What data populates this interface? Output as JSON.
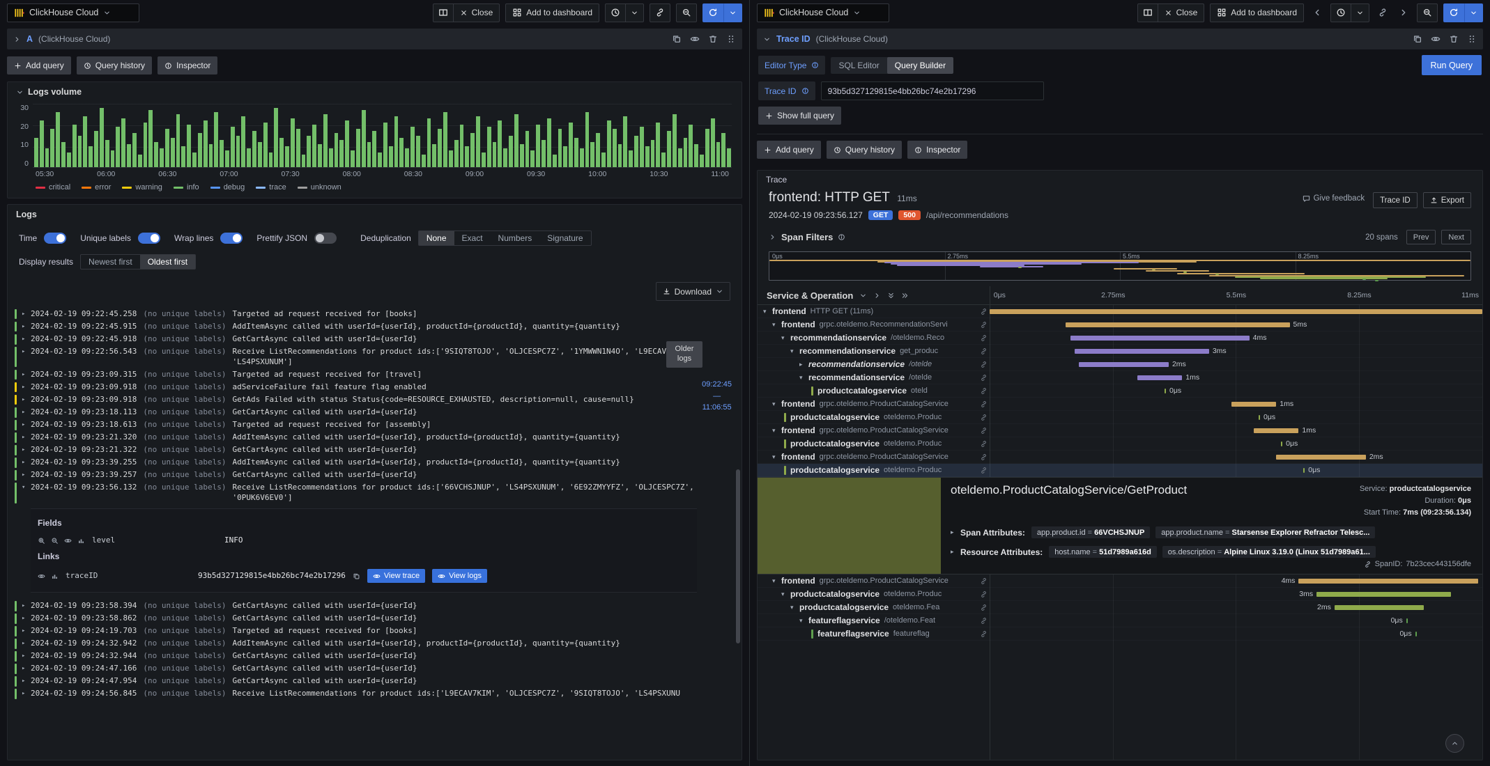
{
  "colors": {
    "accent": "#3d71d9",
    "method_badge": "#3d71d9",
    "status_badge": "#e0562f",
    "detail_block": "#565f2e",
    "levels": {
      "green": "#73bf69",
      "yellow": "#f2cc0c",
      "red": "#e02f44"
    },
    "services": {
      "frontend": "#c9a15c",
      "recommendationservice": "#8c7cc9",
      "productcatalogservice": "#8faa4b",
      "featureflagservice": "#5e9e4e"
    }
  },
  "left": {
    "toolbar": {
      "datasource": "ClickHouse Cloud",
      "close": "Close",
      "add_to_dashboard": "Add to dashboard"
    },
    "query": {
      "ref": "A",
      "datasource_hint": "(ClickHouse Cloud)",
      "add_query": "Add query",
      "query_history": "Query history",
      "inspector": "Inspector"
    },
    "logs_volume": {
      "title": "Logs volume",
      "y_ticks": [
        "30",
        "20",
        "10",
        "0"
      ],
      "x_ticks": [
        "05:30",
        "06:00",
        "06:30",
        "07:00",
        "07:30",
        "08:00",
        "08:30",
        "09:00",
        "09:30",
        "10:00",
        "10:30",
        "11:00"
      ],
      "legend": [
        {
          "label": "critical",
          "color": "#e02f44"
        },
        {
          "label": "error",
          "color": "#ff780a"
        },
        {
          "label": "warning",
          "color": "#f2cc0c"
        },
        {
          "label": "info",
          "color": "#73bf69"
        },
        {
          "label": "debug",
          "color": "#5794f2"
        },
        {
          "label": "trace",
          "color": "#8ab8ff"
        },
        {
          "label": "unknown",
          "color": "#9e9e9e"
        }
      ],
      "y_max": 30,
      "bars": [
        14,
        22,
        9,
        18,
        26,
        12,
        7,
        20,
        15,
        24,
        10,
        17,
        28,
        13,
        8,
        19,
        23,
        11,
        16,
        6,
        21,
        27,
        12,
        9,
        18,
        14,
        25,
        10,
        20,
        7,
        16,
        22,
        11,
        26,
        13,
        8,
        19,
        15,
        24,
        9,
        17,
        12,
        21,
        7,
        28,
        14,
        10,
        23,
        18,
        6,
        15,
        20,
        11,
        25,
        9,
        16,
        13,
        22,
        8,
        18,
        27,
        12,
        17,
        7,
        21,
        10,
        24,
        14,
        9,
        19,
        15,
        6,
        23,
        11,
        18,
        26,
        8,
        13,
        20,
        10,
        16,
        24,
        7,
        19,
        12,
        22,
        9,
        15,
        25,
        11,
        17,
        8,
        20,
        13,
        23,
        6,
        18,
        10,
        21,
        14,
        9,
        26,
        12,
        16,
        7,
        22,
        18,
        11,
        24,
        8,
        15,
        19,
        10,
        13,
        21,
        7,
        17,
        25,
        9,
        14,
        20,
        11,
        6,
        18,
        23,
        12,
        16,
        9
      ]
    },
    "logs": {
      "title": "Logs",
      "controls": {
        "time": "Time",
        "unique_labels": "Unique labels",
        "wrap_lines": "Wrap lines",
        "prettify_json": "Prettify JSON",
        "deduplication": "Deduplication",
        "dedup_options": [
          "None",
          "Exact",
          "Numbers",
          "Signature"
        ],
        "dedup_selected": "None",
        "display_results": "Display results",
        "order_options": [
          "Newest first",
          "Oldest first"
        ],
        "order_selected": "Oldest first",
        "download": "Download"
      },
      "older_logs": "Older logs",
      "time_marker": {
        "from": "09:22:45",
        "dash": "—",
        "to": "11:06:55"
      },
      "rows_before": [
        {
          "ts": "2024-02-19 09:22:45.258",
          "labels": "(no unique labels)",
          "msg": "Targeted ad request received for [books]",
          "level": "green"
        },
        {
          "ts": "2024-02-19 09:22:45.915",
          "labels": "(no unique labels)",
          "msg": "AddItemAsync called with userId={userId}, productId={productId}, quantity={quantity}",
          "level": "green"
        },
        {
          "ts": "2024-02-19 09:22:45.918",
          "labels": "(no unique labels)",
          "msg": "GetCartAsync called with userId={userId}",
          "level": "green"
        },
        {
          "ts": "2024-02-19 09:22:56.543",
          "labels": "(no unique labels)",
          "msg": "Receive ListRecommendations for product ids:['9SIQT8TOJO', 'OLJCESPC7Z', '1YMWWN1N4O', 'L9ECAV7KIM', 'LS4PSXUNUM']",
          "level": "green"
        },
        {
          "ts": "2024-02-19 09:23:09.315",
          "labels": "(no unique labels)",
          "msg": "Targeted ad request received for [travel]",
          "level": "green"
        },
        {
          "ts": "2024-02-19 09:23:09.918",
          "labels": "(no unique labels)",
          "msg": "adServiceFailure fail feature flag enabled",
          "level": "yellow"
        },
        {
          "ts": "2024-02-19 09:23:09.918",
          "labels": "(no unique labels)",
          "msg": "GetAds Failed with status Status{code=RESOURCE_EXHAUSTED, description=null, cause=null}",
          "level": "yellow"
        },
        {
          "ts": "2024-02-19 09:23:18.113",
          "labels": "(no unique labels)",
          "msg": "GetCartAsync called with userId={userId}",
          "level": "green"
        },
        {
          "ts": "2024-02-19 09:23:18.613",
          "labels": "(no unique labels)",
          "msg": "Targeted ad request received for [assembly]",
          "level": "green"
        },
        {
          "ts": "2024-02-19 09:23:21.320",
          "labels": "(no unique labels)",
          "msg": "AddItemAsync called with userId={userId}, productId={productId}, quantity={quantity}",
          "level": "green"
        },
        {
          "ts": "2024-02-19 09:23:21.322",
          "labels": "(no unique labels)",
          "msg": "GetCartAsync called with userId={userId}",
          "level": "green"
        },
        {
          "ts": "2024-02-19 09:23:39.255",
          "labels": "(no unique labels)",
          "msg": "AddItemAsync called with userId={userId}, productId={productId}, quantity={quantity}",
          "level": "green"
        },
        {
          "ts": "2024-02-19 09:23:39.257",
          "labels": "(no unique labels)",
          "msg": "GetCartAsync called with userId={userId}",
          "level": "green"
        },
        {
          "ts": "2024-02-19 09:23:56.132",
          "labels": "(no unique labels)",
          "msg": "Receive ListRecommendations for product ids:['66VCHSJNUP', 'LS4PSXUNUM', '6E92ZMYYFZ', 'OLJCESPC7Z', '0PUK6V6EV0']",
          "level": "green",
          "expanded": true
        }
      ],
      "expanded": {
        "fields_title": "Fields",
        "field_name": "level",
        "field_value": "INFO",
        "links_title": "Links",
        "link_name": "traceID",
        "link_value": "93b5d327129815e4bb26bc74e2b17296",
        "view_trace": "View trace",
        "view_logs": "View logs"
      },
      "rows_after": [
        {
          "ts": "2024-02-19 09:23:58.394",
          "labels": "(no unique labels)",
          "msg": "GetCartAsync called with userId={userId}",
          "level": "green"
        },
        {
          "ts": "2024-02-19 09:23:58.862",
          "labels": "(no unique labels)",
          "msg": "GetCartAsync called with userId={userId}",
          "level": "green"
        },
        {
          "ts": "2024-02-19 09:24:19.703",
          "labels": "(no unique labels)",
          "msg": "Targeted ad request received for [books]",
          "level": "green"
        },
        {
          "ts": "2024-02-19 09:24:32.942",
          "labels": "(no unique labels)",
          "msg": "AddItemAsync called with userId={userId}, productId={productId}, quantity={quantity}",
          "level": "green"
        },
        {
          "ts": "2024-02-19 09:24:32.944",
          "labels": "(no unique labels)",
          "msg": "GetCartAsync called with userId={userId}",
          "level": "green"
        },
        {
          "ts": "2024-02-19 09:24:47.166",
          "labels": "(no unique labels)",
          "msg": "GetCartAsync called with userId={userId}",
          "level": "green"
        },
        {
          "ts": "2024-02-19 09:24:47.954",
          "labels": "(no unique labels)",
          "msg": "GetCartAsync called with userId={userId}",
          "level": "green"
        },
        {
          "ts": "2024-02-19 09:24:56.845",
          "labels": "(no unique labels)",
          "msg": "Receive ListRecommendations for product ids:['L9ECAV7KIM', 'OLJCESPC7Z', '9SIQT8TOJO', 'LS4PSXUNU",
          "level": "green"
        }
      ]
    }
  },
  "right": {
    "toolbar": {
      "datasource": "ClickHouse Cloud",
      "close": "Close",
      "add_to_dashboard": "Add to dashboard"
    },
    "query": {
      "name": "Trace ID",
      "datasource_hint": "(ClickHouse Cloud)",
      "editor_type_label": "Editor Type",
      "editor_options": [
        "SQL Editor",
        "Query Builder"
      ],
      "editor_selected": "Query Builder",
      "trace_id_label": "Trace ID",
      "trace_id_value": "93b5d327129815e4bb26bc74e2b17296",
      "show_full_query": "Show full query",
      "run_query": "Run Query",
      "add_query": "Add query",
      "query_history": "Query history",
      "inspector": "Inspector"
    },
    "trace": {
      "panel_title": "Trace",
      "title": "frontend: HTTP GET",
      "duration": "11ms",
      "timestamp": "2024-02-19 09:23:56.127",
      "method": "GET",
      "status": "500",
      "url": "/api/recommendations",
      "give_feedback": "Give feedback",
      "trace_id_btn": "Trace ID",
      "export": "Export",
      "span_filters": "Span Filters",
      "span_count": "20 spans",
      "prev": "Prev",
      "next": "Next",
      "header": "Service & Operation",
      "total_ms": 11,
      "ticks": [
        "0μs",
        "2.75ms",
        "5.5ms",
        "8.25ms",
        "11ms"
      ],
      "minimap_ticks": [
        "0μs",
        "2.75ms",
        "5.5ms",
        "8.25ms"
      ],
      "spans": [
        {
          "service": "frontend",
          "operation": "HTTP GET (11ms)",
          "duration_label": "",
          "start_ms": 0,
          "len_ms": 11,
          "svc": "frontend",
          "depth": 0,
          "chevron": "down"
        },
        {
          "service": "frontend",
          "operation": "grpc.oteldemo.RecommendationServi",
          "duration_label": "5ms",
          "start_ms": 1.7,
          "len_ms": 5,
          "svc": "frontend",
          "depth": 1,
          "chevron": "down"
        },
        {
          "service": "recommendationservice",
          "operation": "/oteldemo.Reco",
          "duration_label": "4ms",
          "start_ms": 1.8,
          "len_ms": 4,
          "svc": "recommendationservice",
          "depth": 2,
          "chevron": "down"
        },
        {
          "service": "recommendationservice",
          "operation": "get_produc",
          "duration_label": "3ms",
          "start_ms": 1.9,
          "len_ms": 3,
          "svc": "recommendationservice",
          "depth": 3,
          "chevron": "down"
        },
        {
          "service": "recommendationservice",
          "operation": "/otelde",
          "duration_label": "2ms",
          "start_ms": 2.0,
          "len_ms": 2,
          "svc": "recommendationservice",
          "depth": 4,
          "chevron": "right",
          "italic": true
        },
        {
          "service": "recommendationservice",
          "operation": "/otelde",
          "duration_label": "1ms",
          "start_ms": 3.3,
          "len_ms": 1,
          "svc": "recommendationservice",
          "depth": 4,
          "chevron": "down"
        },
        {
          "service": "productcatalogservice",
          "operation": "oteld",
          "duration_label": "0μs",
          "start_ms": 3.9,
          "len_ms": 0,
          "svc": "productcatalogservice",
          "depth": 5,
          "leaf": true
        },
        {
          "service": "frontend",
          "operation": "grpc.oteldemo.ProductCatalogService",
          "duration_label": "1ms",
          "start_ms": 5.4,
          "len_ms": 1,
          "svc": "frontend",
          "depth": 1,
          "chevron": "down"
        },
        {
          "service": "productcatalogservice",
          "operation": "oteldemo.Produc",
          "duration_label": "0μs",
          "start_ms": 6.0,
          "len_ms": 0,
          "svc": "productcatalogservice",
          "depth": 2,
          "leaf": true
        },
        {
          "service": "frontend",
          "operation": "grpc.oteldemo.ProductCatalogService",
          "duration_label": "1ms",
          "start_ms": 5.9,
          "len_ms": 1,
          "svc": "frontend",
          "depth": 1,
          "chevron": "down"
        },
        {
          "service": "productcatalogservice",
          "operation": "oteldemo.Produc",
          "duration_label": "0μs",
          "start_ms": 6.5,
          "len_ms": 0,
          "svc": "productcatalogservice",
          "depth": 2,
          "leaf": true
        },
        {
          "service": "frontend",
          "operation": "grpc.oteldemo.ProductCatalogService",
          "duration_label": "2ms",
          "start_ms": 6.4,
          "len_ms": 2,
          "svc": "frontend",
          "depth": 1,
          "chevron": "down"
        },
        {
          "service": "productcatalogservice",
          "operation": "oteldemo.Produc",
          "duration_label": "0μs",
          "start_ms": 7.0,
          "len_ms": 0,
          "svc": "productcatalogservice",
          "depth": 2,
          "leaf": true,
          "selected": true
        },
        {
          "service": "frontend",
          "operation": "grpc.oteldemo.ProductCatalogService",
          "duration_label": "4ms",
          "start_ms": 6.9,
          "len_ms": 4,
          "svc": "frontend",
          "depth": 1,
          "chevron": "down"
        },
        {
          "service": "productcatalogservice",
          "operation": "oteldemo.Produc",
          "duration_label": "3ms",
          "start_ms": 7.3,
          "len_ms": 3,
          "svc": "productcatalogservice",
          "depth": 2,
          "chevron": "down"
        },
        {
          "service": "productcatalogservice",
          "operation": "oteldemo.Fea",
          "duration_label": "2ms",
          "start_ms": 7.7,
          "len_ms": 2,
          "svc": "productcatalogservice",
          "depth": 3,
          "chevron": "down"
        },
        {
          "service": "featureflagservice",
          "operation": "/oteldemo.Feat",
          "duration_label": "0μs",
          "start_ms": 9.3,
          "len_ms": 0,
          "svc": "featureflagservice",
          "depth": 4,
          "chevron": "down"
        },
        {
          "service": "featureflagservice",
          "operation": "featureflag",
          "duration_label": "0μs",
          "start_ms": 9.5,
          "len_ms": 0,
          "svc": "featureflagservice",
          "depth": 5,
          "leaf": true
        }
      ],
      "detail": {
        "title": "oteldemo.ProductCatalogService/GetProduct",
        "service_label": "Service:",
        "service": "productcatalogservice",
        "duration_label": "Duration:",
        "duration": "0μs",
        "start_label": "Start Time:",
        "start": "7ms (09:23:56.134)",
        "span_attrs_label": "Span Attributes:",
        "span_attrs": [
          {
            "k": "app.product.id",
            "v": "66VCHSJNUP"
          },
          {
            "k": "app.product.name",
            "v": "Starsense Explorer Refractor Telesc..."
          }
        ],
        "resource_attrs_label": "Resource Attributes:",
        "resource_attrs": [
          {
            "k": "host.name",
            "v": "51d7989a616d"
          },
          {
            "k": "os.description",
            "v": "Alpine Linux 3.19.0 (Linux 51d7989a61..."
          }
        ],
        "span_id_label": "SpanID:",
        "span_id": "7b23cec443156dfe"
      }
    }
  }
}
